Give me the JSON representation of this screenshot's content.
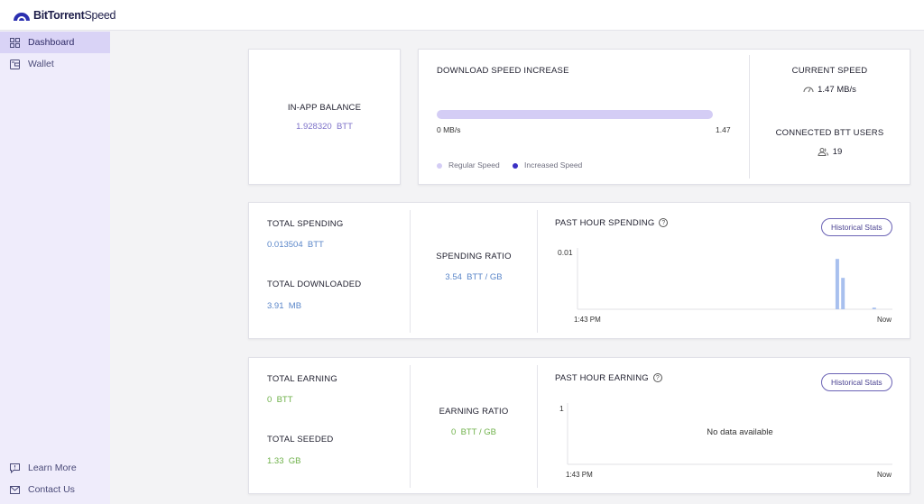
{
  "app": {
    "logo_bold": "BitTorrent",
    "logo_light": "Speed"
  },
  "sidebar": {
    "items": [
      {
        "label": "Dashboard",
        "icon": "grid-icon",
        "active": true
      },
      {
        "label": "Wallet",
        "icon": "wallet-icon",
        "active": false
      }
    ],
    "footer": [
      {
        "label": "Learn More",
        "icon": "message-icon"
      },
      {
        "label": "Contact Us",
        "icon": "mail-icon"
      }
    ]
  },
  "balance": {
    "label": "IN-APP BALANCE",
    "value": "1.928320",
    "unit": "BTT"
  },
  "download_speed": {
    "title": "DOWNLOAD SPEED INCREASE",
    "min_label": "0 MB/s",
    "max_label": "1.47",
    "legend_regular": "Regular Speed",
    "legend_increased": "Increased Speed",
    "color_regular": "#d4cdf5",
    "color_increased": "#3a2fc4"
  },
  "current_speed": {
    "label": "CURRENT SPEED",
    "value": "1.47 MB/s",
    "icon": "speedometer-icon"
  },
  "connected_users": {
    "label": "CONNECTED BTT USERS",
    "value": "19",
    "icon": "users-icon"
  },
  "spending": {
    "total_label": "TOTAL SPENDING",
    "total_value": "0.013504",
    "total_unit": "BTT",
    "downloaded_label": "TOTAL DOWNLOADED",
    "downloaded_value": "3.91",
    "downloaded_unit": "MB",
    "ratio_label": "SPENDING RATIO",
    "ratio_value": "3.54",
    "ratio_unit": "BTT / GB",
    "chart_title": "PAST HOUR SPENDING",
    "history_button": "Historical Stats"
  },
  "earning": {
    "total_label": "TOTAL EARNING",
    "total_value": "0",
    "total_unit": "BTT",
    "seeded_label": "TOTAL SEEDED",
    "seeded_value": "1.33",
    "seeded_unit": "GB",
    "ratio_label": "EARNING RATIO",
    "ratio_value": "0",
    "ratio_unit": "BTT / GB",
    "chart_title": "PAST HOUR EARNING",
    "history_button": "Historical Stats",
    "no_data": "No data available"
  },
  "chart_data": [
    {
      "type": "bar",
      "x_start_label": "1:43 PM",
      "x_end_label": "Now",
      "y_tick_label": "0.01",
      "ylim": [
        0,
        0.01
      ],
      "x": [
        0.825,
        0.843,
        0.942
      ],
      "values": [
        0.0093,
        0.0058,
        0.0003
      ],
      "x_range": [
        0,
        1
      ],
      "color": "#a8c0ee"
    },
    {
      "type": "bar",
      "x_start_label": "1:43 PM",
      "x_end_label": "Now",
      "y_tick_label": "1",
      "ylim": [
        0,
        1
      ],
      "values": []
    }
  ]
}
